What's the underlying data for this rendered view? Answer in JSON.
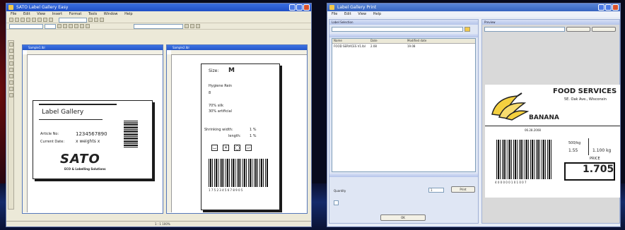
{
  "left_app": {
    "title": "SATO Label Gallery Easy",
    "menu": [
      "File",
      "Edit",
      "View",
      "Insert",
      "Format",
      "Tools",
      "Window",
      "Help"
    ],
    "docs": {
      "doc1_title": "Sample1.lbl",
      "doc2_title": "Sample2.lbl"
    },
    "label1": {
      "heading": "Label Gallery",
      "article_no_label": "Article No:",
      "article_no_value": "1234567890",
      "current_date_label": "Current Date:",
      "current_date_value": "x weights  x",
      "brand": "SATO",
      "tagline": "ECO & Labelling Solutions"
    },
    "label2": {
      "size_label": "Size:",
      "size_value": "M",
      "hygiene_text": "Hygiene Rein",
      "hygiene_num": "8",
      "material1": "70% silk",
      "material2": "30% artificial",
      "shrink_width_label": "Shrinking width:",
      "shrink_width_value": "1 %",
      "shrink_length_label": "length:",
      "shrink_length_value": "1 %",
      "care_icons": [
        "wash-icon",
        "no-bleach-icon",
        "tumble-dry-icon",
        "iron-icon"
      ],
      "barcode_digits": "1 7 5 2 3 4 5 6 7 8 9 0 5"
    },
    "status": "1 : 1     100%"
  },
  "right_app": {
    "title": "Label Gallery Print",
    "panel_left_title": "Label Selection",
    "panel_right_title": "Preview",
    "list_columns": [
      "Name",
      "Date",
      "Modified date"
    ],
    "list_rows": [
      {
        "name": "FOOD SERVICES V1.lbl",
        "date": "2.08",
        "modified": "19.08"
      }
    ],
    "quantity_label": "Quantity",
    "quantity_value": "1",
    "print_button": "Print",
    "ok_button": "OK",
    "preview_label": {
      "company": "FOOD SERVICES",
      "address": "5E. Oak Ave., Wisconsin",
      "product": "BANANA",
      "date": "06.28.2008",
      "weight_unit_left": "500/kg",
      "weight_price_left": "1.55",
      "weight_value": "1.100 kg",
      "price_label": "PRICE",
      "price_value": "1.705",
      "barcode_digits": "4 0 0 0 0 0 1 0 1 0 0 7"
    }
  }
}
